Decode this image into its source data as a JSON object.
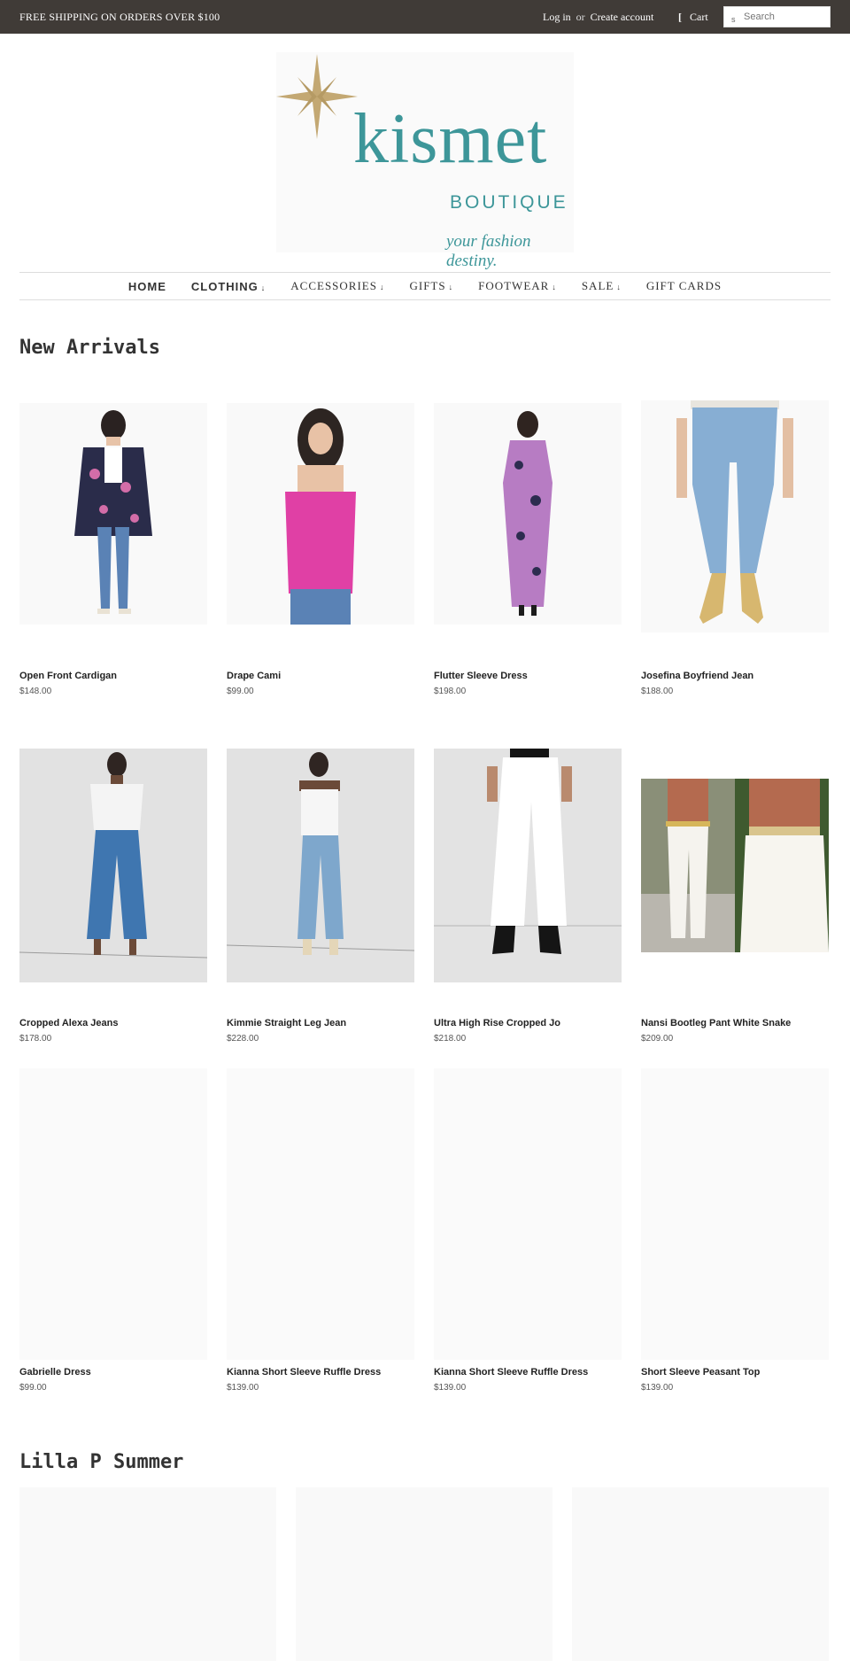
{
  "topbar": {
    "promo": "FREE SHIPPING ON ORDERS OVER $100",
    "login": "Log in",
    "or": "or",
    "create_account": "Create account",
    "cart": "Cart",
    "search_placeholder": "Search"
  },
  "logo": {
    "wordmark": "kismet",
    "sub": "BOUTIQUE",
    "tagline": "your fashion destiny."
  },
  "nav": [
    {
      "label": "HOME",
      "has_caret": false
    },
    {
      "label": "CLOTHING",
      "has_caret": true,
      "caret": "↓"
    },
    {
      "label": "ACCESSORIES",
      "has_caret": true,
      "caret": "↓"
    },
    {
      "label": "GIFTS",
      "has_caret": true,
      "caret": "↓"
    },
    {
      "label": "FOOTWEAR",
      "has_caret": true,
      "caret": "↓"
    },
    {
      "label": "SALE",
      "has_caret": true,
      "caret": "↓"
    },
    {
      "label": "GIFT CARDS",
      "has_caret": false
    }
  ],
  "new_arrivals": {
    "title": "New Arrivals",
    "products": [
      {
        "name": "Open Front Cardigan",
        "price": "$148.00"
      },
      {
        "name": "Drape Cami",
        "price": "$99.00"
      },
      {
        "name": "Flutter Sleeve Dress",
        "price": "$198.00"
      },
      {
        "name": "Josefina Boyfriend Jean",
        "price": "$188.00"
      },
      {
        "name": "Cropped Alexa Jeans",
        "price": "$178.00"
      },
      {
        "name": "Kimmie Straight Leg Jean",
        "price": "$228.00"
      },
      {
        "name": "Ultra High Rise Cropped Jo",
        "price": "$218.00"
      },
      {
        "name": "Nansi Bootleg Pant White Snake",
        "price": "$209.00"
      },
      {
        "name": "Gabrielle Dress",
        "price": "$99.00"
      },
      {
        "name": "Kianna Short Sleeve Ruffle Dress",
        "price": "$139.00"
      },
      {
        "name": "Kianna Short Sleeve Ruffle Dress",
        "price": "$139.00"
      },
      {
        "name": "Short Sleeve Peasant Top",
        "price": "$139.00"
      }
    ]
  },
  "lilla": {
    "title": "Lilla P Summer"
  },
  "colors": {
    "topbar_bg": "#403b37",
    "brand_teal": "#3d9699",
    "star_gold": "#c3a873"
  }
}
